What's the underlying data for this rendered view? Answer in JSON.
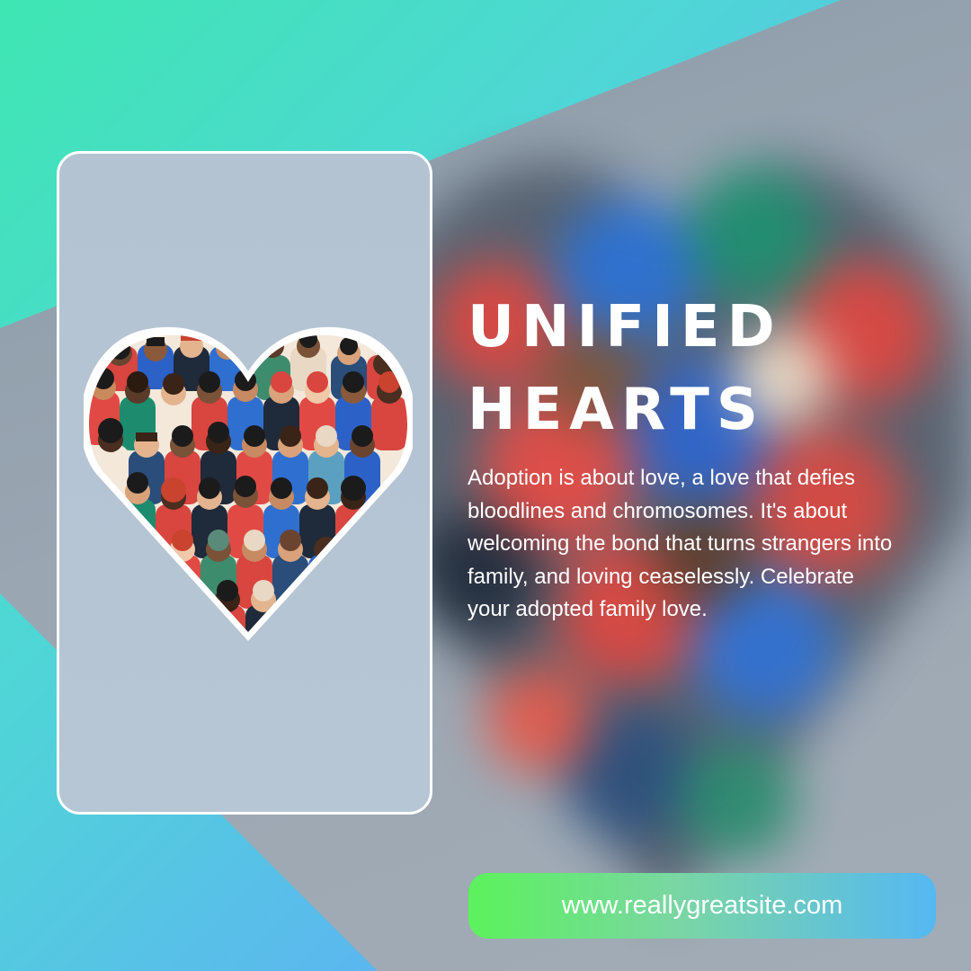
{
  "headline": {
    "line1": "UNIFIED",
    "line2": "HEARTS"
  },
  "body": "Adoption is about love, a love that defies bloodlines and chromosomes. It's about welcoming the bond that turns strangers into family, and loving ceaselessly. Celebrate your adopted family love.",
  "website": "www.reallygreatsite.com",
  "colors": {
    "accent_green": "#5cf25c",
    "accent_blue": "#55b8f2",
    "card_fill": "#b5c4d3",
    "text": "#ffffff"
  },
  "illustration": {
    "heart_icon": "heart-of-diverse-people-icon"
  }
}
